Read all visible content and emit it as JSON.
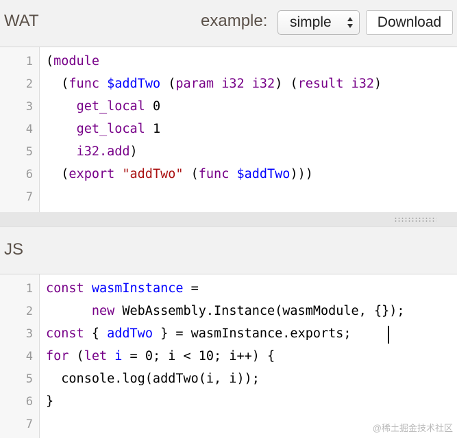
{
  "wat": {
    "title": "WAT",
    "example_label": "example:",
    "example_selected": "simple",
    "download_label": "Download",
    "lines": [
      {
        "num": "1",
        "tokens": [
          {
            "t": "(",
            "c": ""
          },
          {
            "t": "module",
            "c": "kw"
          }
        ]
      },
      {
        "num": "2",
        "tokens": [
          {
            "t": "  (",
            "c": ""
          },
          {
            "t": "func",
            "c": "kw"
          },
          {
            "t": " ",
            "c": ""
          },
          {
            "t": "$addTwo",
            "c": "def"
          },
          {
            "t": " (",
            "c": ""
          },
          {
            "t": "param",
            "c": "kw"
          },
          {
            "t": " ",
            "c": ""
          },
          {
            "t": "i32",
            "c": "kw"
          },
          {
            "t": " ",
            "c": ""
          },
          {
            "t": "i32",
            "c": "kw"
          },
          {
            "t": ") (",
            "c": ""
          },
          {
            "t": "result",
            "c": "kw"
          },
          {
            "t": " ",
            "c": ""
          },
          {
            "t": "i32",
            "c": "kw"
          },
          {
            "t": ")",
            "c": ""
          }
        ]
      },
      {
        "num": "3",
        "tokens": [
          {
            "t": "    ",
            "c": ""
          },
          {
            "t": "get_local",
            "c": "kw"
          },
          {
            "t": " 0",
            "c": ""
          }
        ]
      },
      {
        "num": "4",
        "tokens": [
          {
            "t": "    ",
            "c": ""
          },
          {
            "t": "get_local",
            "c": "kw"
          },
          {
            "t": " 1",
            "c": ""
          }
        ]
      },
      {
        "num": "5",
        "tokens": [
          {
            "t": "    ",
            "c": ""
          },
          {
            "t": "i32.add",
            "c": "kw"
          },
          {
            "t": ")",
            "c": ""
          }
        ]
      },
      {
        "num": "6",
        "tokens": [
          {
            "t": "  (",
            "c": ""
          },
          {
            "t": "export",
            "c": "kw"
          },
          {
            "t": " ",
            "c": ""
          },
          {
            "t": "\"addTwo\"",
            "c": "str"
          },
          {
            "t": " (",
            "c": ""
          },
          {
            "t": "func",
            "c": "kw"
          },
          {
            "t": " ",
            "c": ""
          },
          {
            "t": "$addTwo",
            "c": "def"
          },
          {
            "t": ")))",
            "c": ""
          }
        ]
      },
      {
        "num": "7",
        "tokens": []
      }
    ]
  },
  "js": {
    "title": "JS",
    "lines": [
      {
        "num": "1",
        "tokens": [
          {
            "t": "const",
            "c": "kw"
          },
          {
            "t": " ",
            "c": ""
          },
          {
            "t": "wasmInstance",
            "c": "def"
          },
          {
            "t": " =",
            "c": ""
          }
        ]
      },
      {
        "num": "2",
        "tokens": [
          {
            "t": "      ",
            "c": ""
          },
          {
            "t": "new",
            "c": "kw"
          },
          {
            "t": " WebAssembly.Instance(wasmModule, {});",
            "c": ""
          }
        ]
      },
      {
        "num": "3",
        "tokens": [
          {
            "t": "const",
            "c": "kw"
          },
          {
            "t": " { ",
            "c": ""
          },
          {
            "t": "addTwo",
            "c": "def"
          },
          {
            "t": " } = wasmInstance.exports;",
            "c": ""
          }
        ]
      },
      {
        "num": "4",
        "tokens": [
          {
            "t": "for",
            "c": "kw"
          },
          {
            "t": " (",
            "c": ""
          },
          {
            "t": "let",
            "c": "kw"
          },
          {
            "t": " ",
            "c": ""
          },
          {
            "t": "i",
            "c": "def"
          },
          {
            "t": " = 0; i < 10; i++) {",
            "c": ""
          }
        ]
      },
      {
        "num": "5",
        "tokens": [
          {
            "t": "  console.log(addTwo(i, i));",
            "c": ""
          }
        ]
      },
      {
        "num": "6",
        "tokens": [
          {
            "t": "}",
            "c": ""
          }
        ]
      },
      {
        "num": "7",
        "tokens": []
      }
    ]
  },
  "watermark": "@稀土掘金技术社区",
  "colors": {
    "keyword": "#770088",
    "definition": "#0000ff",
    "string": "#aa1111"
  },
  "icons": {
    "select_arrows": "up-down-arrows-icon",
    "splitter": "resize-grip-icon"
  }
}
